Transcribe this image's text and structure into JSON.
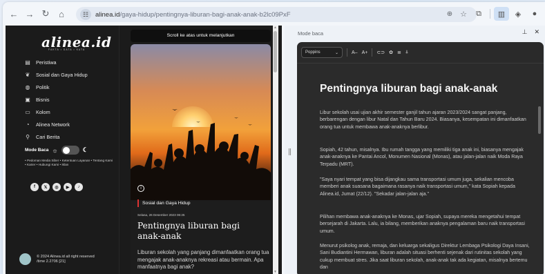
{
  "browser": {
    "url_domain": "alinea.id",
    "url_path": "/gaya-hidup/pentingnya-liburan-bagi-anak-anak-b2lc09PxF",
    "reading_mode_label": "Mode baca"
  },
  "site": {
    "logo": "alinea.id",
    "tagline": "FAKTA • DATA • KATA",
    "menu": [
      {
        "icon": "document-icon",
        "label": "Peristiwa"
      },
      {
        "icon": "plant-icon",
        "label": "Sosial dan Gaya Hidup"
      },
      {
        "icon": "globe-icon",
        "label": "Politik"
      },
      {
        "icon": "briefcase-icon",
        "label": "Bisnis"
      },
      {
        "icon": "monitor-icon",
        "label": "Kolom"
      },
      {
        "icon": "network-icon",
        "label": "Alinea Network"
      },
      {
        "icon": "search-icon",
        "label": "Cari Berita"
      }
    ],
    "mode_baca": "Mode Baca",
    "links": "• Pedoman Media Siber • Ketentuan Layanan • Tentang Kami • Karier • Hubungi Kami • Iklan",
    "social": [
      "f",
      "𝕏",
      "◎",
      "▶",
      "♪"
    ],
    "copyright": "© 2024 Alinea.id all right reserved",
    "version": "/time 2.2706 [21]"
  },
  "article": {
    "scroll_note": "Scroll ke atas untuk melanjutkan",
    "category": "Sosial dan Gaya Hidup",
    "date": "Selasa, 26 Desember 2023 06:25",
    "title": "Pentingnya liburan bagi anak-anak",
    "lead": "Liburan sekolah yang panjang dimanfaatkan orang tua mengajak anak-anaknya rekreasi atau bermain. Apa manfaatnya bagi anak?"
  },
  "reader": {
    "font": "Poppins",
    "title": "Pentingnya liburan bagi anak-anak",
    "paragraphs": [
      "Libur sekolah usai ujian akhir semester ganjil tahun ajaran 2023/2024 sangat panjang, berbarengan dengan libur Natal dan Tahun Baru 2024. Biasanya, kesempatan ini dimanfaatkan orang tua untuk membawa anak-anaknya berlibur.",
      "Sopiah, 42 tahun, misalnya. Ibu rumah tangga yang memiliki tiga anak ini, biasanya mengajak anak-anaknya ke Pantai Ancol, Monumen Nasional (Monas), atau jalan-jalan naik Moda Raya Terpadu (MRT).",
      "\"Saya nyari tempat yang bisa dijangkau sama transportasi umum juga, sekalian mencoba memberi anak suasana bagaimana rasanya naik transportasi umum,\" kata Sopiah kepada Alinea.id, Jumat (22/12). \"Sekadar jalan-jalan aja.\"",
      "Pilihan membawa anak-anaknya ke Monas, ujar Sopiah, supaya mereka mengetahui tempat bersejarah di Jakarta. Lalu, ia bilang, memberikan anaknya pengalaman baru naik transportasi umum.",
      "Menurut psikolog anak, remaja, dan keluarga sekaligus Direktur Lembaga Psikologi Daya Insani, Sani Budiantini Hermawan, liburan adalah situasi berhenti sejenak dari rutinitas sekolah yang cukup membuat stres. Jika saat liburan sekolah, anak-anak tak ada kegiatan, misalnya bertemu dan"
    ]
  }
}
